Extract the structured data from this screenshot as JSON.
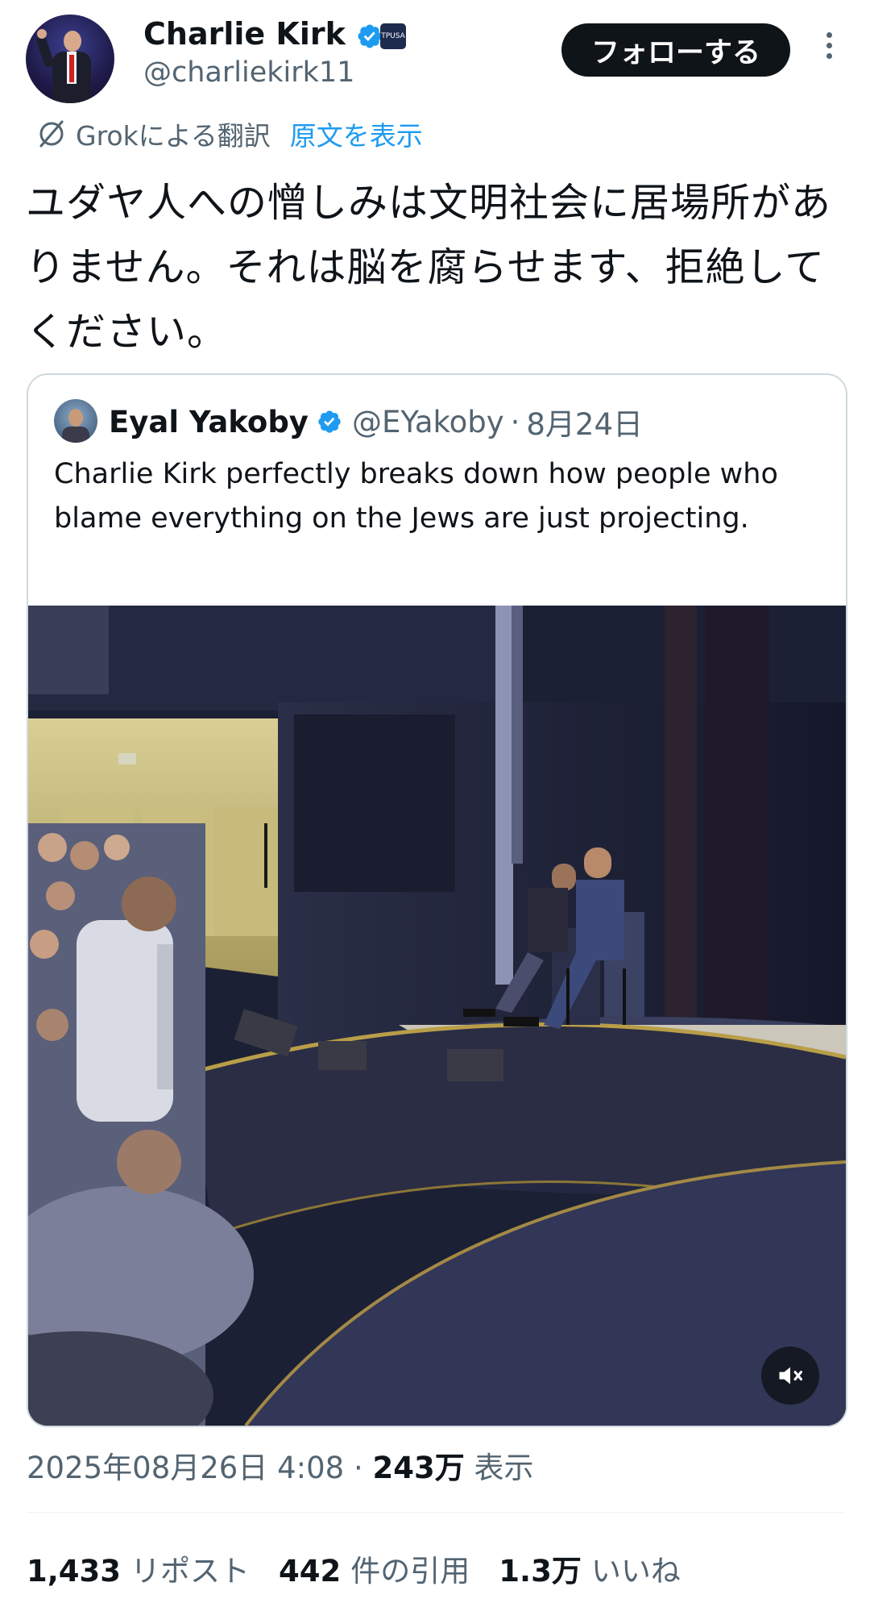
{
  "author": {
    "name": "Charlie Kirk",
    "handle": "@charliekirk11",
    "affiliation_badge_text": "TPUSA",
    "verified": true,
    "verified_color": "#1d9bf0"
  },
  "follow_label": "フォローする",
  "translation": {
    "provider_label": "Grokによる翻訳",
    "show_original_label": "原文を表示"
  },
  "tweet_text": "ユダヤ人への憎しみは文明社会に居場所がありません。それは脳を腐らせます、拒絶してください。",
  "quoted": {
    "name": "Eyal Yakoby",
    "handle": "@EYakoby",
    "separator": "·",
    "date": "8月24日",
    "text": "Charlie Kirk perfectly breaks down how people who blame everything on the Jews are just projecting.",
    "media": {
      "type": "video",
      "muted": true,
      "description_icon": "mute-icon"
    }
  },
  "meta": {
    "timestamp": "2025年08月26日 4:08",
    "separator": "·",
    "views_count": "243万",
    "views_label": "表示"
  },
  "stats": [
    {
      "count": "1,433",
      "label": "リポスト"
    },
    {
      "count": "442",
      "label": "件の引用"
    },
    {
      "count": "1.3万",
      "label": "いいね"
    }
  ],
  "colors": {
    "text_primary": "#0f1419",
    "text_secondary": "#536471",
    "link_blue": "#1d9bf0",
    "border": "#cfd9de"
  }
}
